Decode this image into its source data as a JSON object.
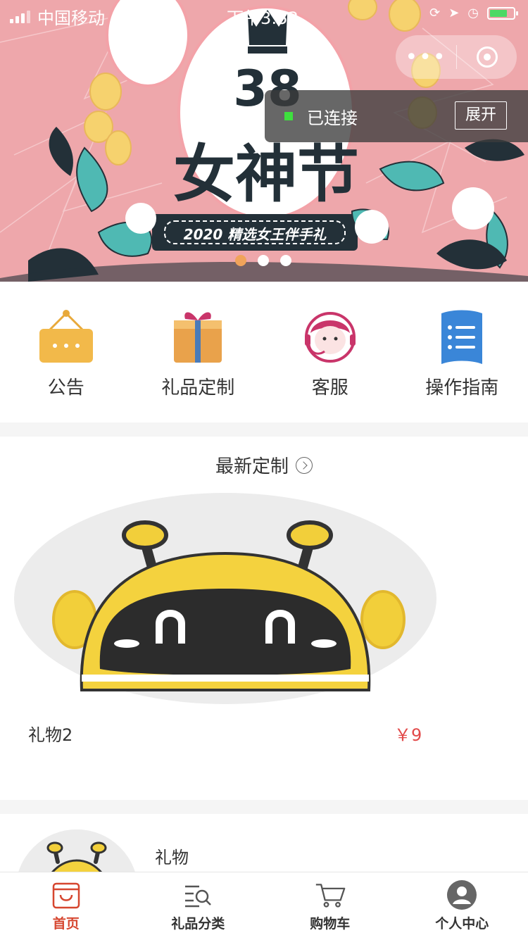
{
  "status_bar": {
    "carrier": "中国移动",
    "time": "下午3:53"
  },
  "banner": {
    "headline": "38女神节",
    "tagline": "2020 精选女王伴手礼",
    "dots": 3,
    "active_dot": 0
  },
  "capsule": {
    "more_icon": "more-dots-icon",
    "close_icon": "target-close-icon"
  },
  "connection": {
    "status": "已连接",
    "expand_label": "展开"
  },
  "quick_menu": [
    {
      "label": "公告",
      "icon": "notice-board-icon"
    },
    {
      "label": "礼品定制",
      "icon": "gift-box-icon"
    },
    {
      "label": "客服",
      "icon": "customer-service-icon"
    },
    {
      "label": "操作指南",
      "icon": "guide-book-icon"
    }
  ],
  "section": {
    "title": "最新定制"
  },
  "products": [
    {
      "name": "礼物2",
      "price": "￥9"
    },
    {
      "name": "礼物"
    }
  ],
  "tabbar": [
    {
      "label": "首页",
      "icon": "home-bag-icon",
      "active": true
    },
    {
      "label": "礼品分类",
      "icon": "category-search-icon"
    },
    {
      "label": "购物车",
      "icon": "cart-icon"
    },
    {
      "label": "个人中心",
      "icon": "user-icon"
    }
  ],
  "colors": {
    "banner_bg": "#eea7ab",
    "active_tab": "#d6462f",
    "price": "#e24a4a",
    "dot_active": "#f0a35a"
  }
}
